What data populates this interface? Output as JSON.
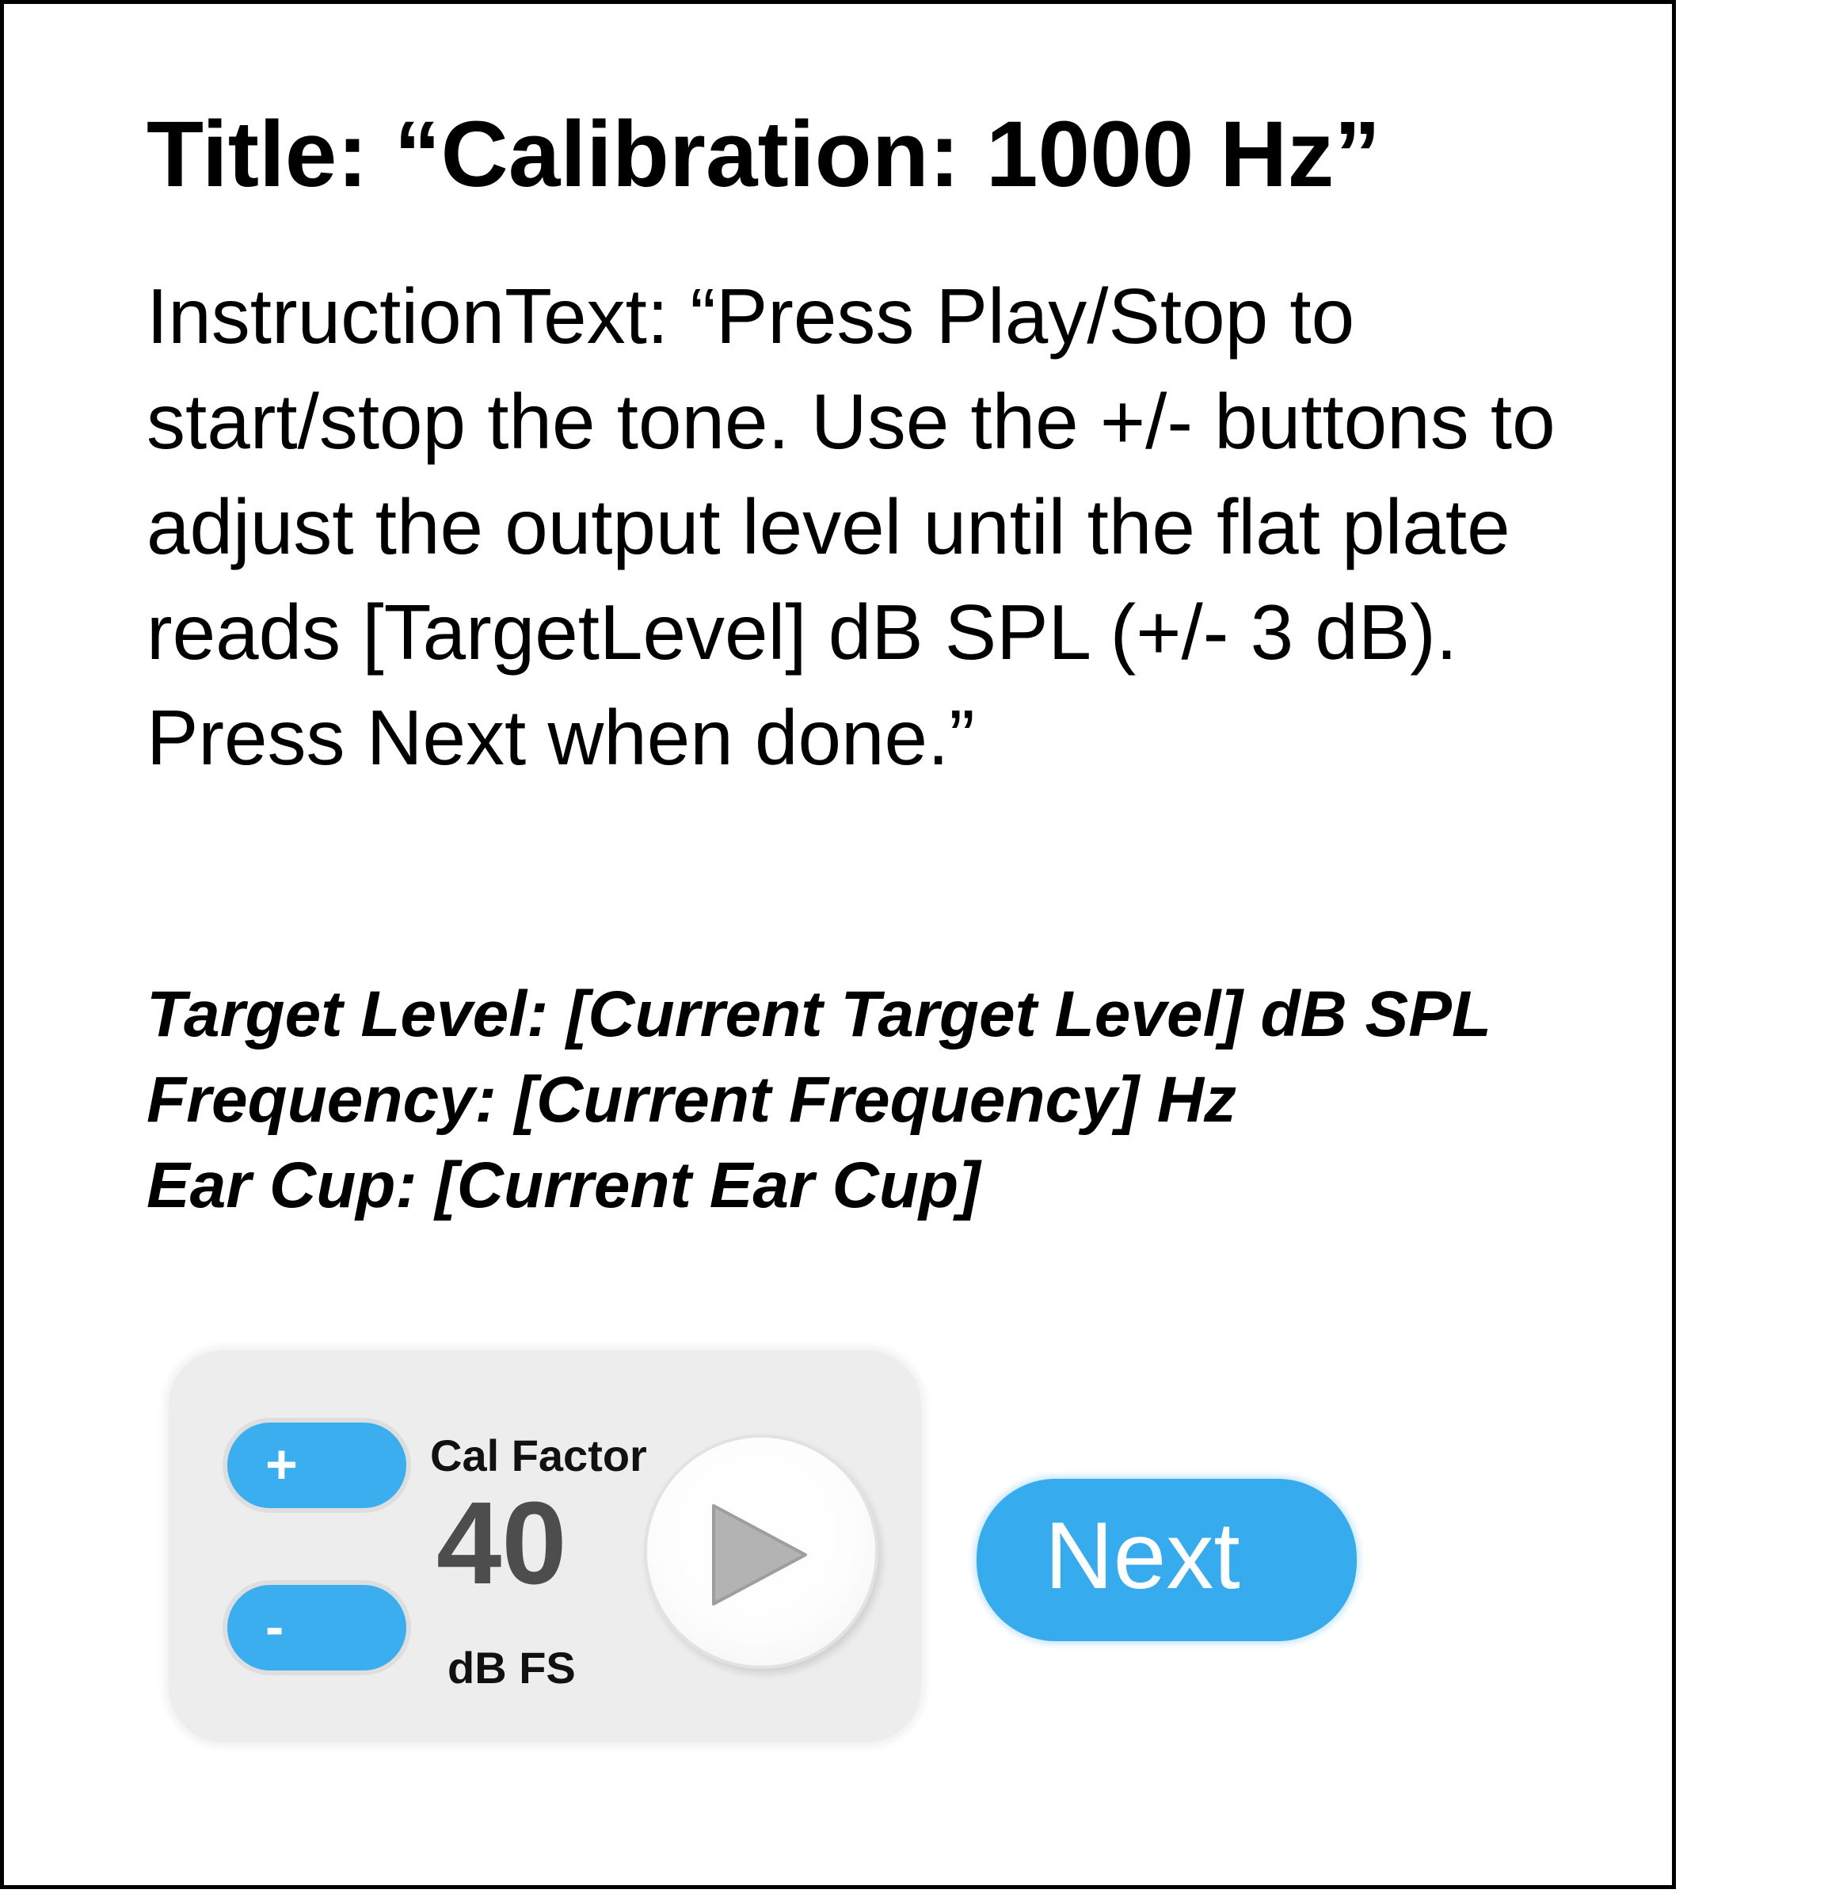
{
  "title": "Title: “Calibration: 1000 Hz”",
  "instruction": "InstructionText: “Press Play/Stop to start/stop the tone. Use the +/- buttons to adjust the output level until the flat plate reads [TargetLevel] dB SPL (+/- 3 dB). Press Next when done.”",
  "info": {
    "target_level": "Target Level: [Current Target Level] dB SPL",
    "frequency": "Frequency: [Current Frequency] Hz",
    "ear_cup": "Ear Cup: [Current Ear Cup]"
  },
  "control_panel": {
    "plus_label": "+",
    "minus_label": "-",
    "cal_factor_label": "Cal Factor",
    "cal_factor_value": "40",
    "unit_label": "dB FS",
    "play_icon": "play-icon"
  },
  "next_button": {
    "label": "Next"
  },
  "colors": {
    "button_blue": "#36abed",
    "panel_gray": "#ededed",
    "value_gray": "#4d4d4d",
    "play_triangle": "#b3b3b3"
  }
}
